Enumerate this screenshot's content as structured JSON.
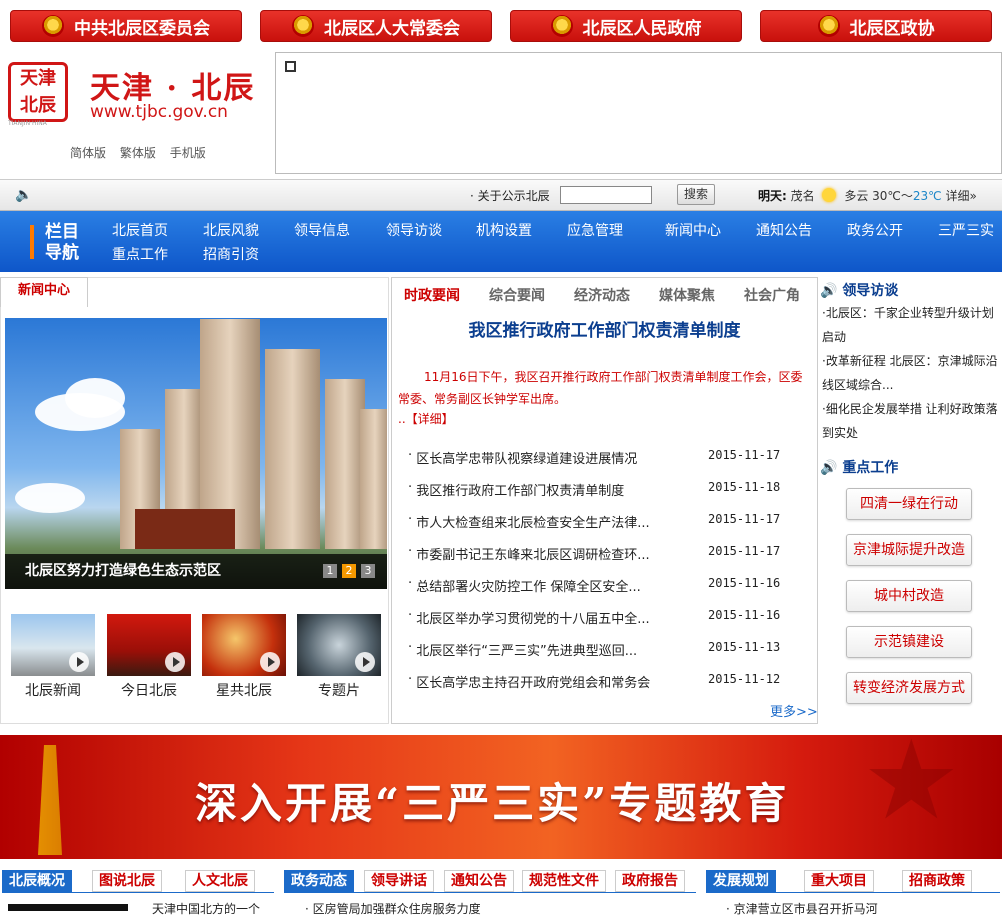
{
  "top_links": [
    "中共北辰区委员会",
    "北辰区人大常委会",
    "北辰区人民政府",
    "北辰区政协"
  ],
  "header": {
    "seal_text": [
      "天津",
      "北辰"
    ],
    "seal_sub": "TIANJIN·HINA",
    "title": "天津 · 北辰",
    "url": "www.tjbc.gov.cn",
    "versions": [
      "简体版",
      "繁体版",
      "手机版"
    ]
  },
  "toolbar": {
    "notice": "· 关于公示北辰",
    "search_label": "搜索",
    "weather": {
      "day": "明天:",
      "city": "茂名",
      "cond": "多云",
      "high": "30℃～",
      "low": "23℃",
      "detail": "详细»"
    }
  },
  "nav": {
    "title_line1": "栏目",
    "title_line2": "导航",
    "row1": [
      "北辰首页",
      "北辰风貌",
      "领导信息",
      "领导访谈",
      "机构设置",
      "应急管理",
      "新闻中心",
      "通知公告",
      "政务公开",
      "三严三实"
    ],
    "row2": [
      "重点工作",
      "招商引资"
    ]
  },
  "news_center": {
    "tab": "新闻中心",
    "caption": "北辰区努力打造绿色生态示范区",
    "pages": [
      "1",
      "2",
      "3"
    ],
    "thumbs": [
      "北辰新闻",
      "今日北辰",
      "星共北辰",
      "专题片"
    ]
  },
  "middle": {
    "tabs": [
      "时政要闻",
      "综合要闻",
      "经济动态",
      "媒体聚焦",
      "社会广角"
    ],
    "headline": "我区推行政府工作部门权责清单制度",
    "summary": "11月16日下午，我区召开推行政府工作部门权责清单制度工作会，区委常委、常务副区长钟学军出席。",
    "detail": "..【详细】",
    "items": [
      {
        "title": "区长高学忠带队视察绿道建设进展情况",
        "date": "2015-11-17"
      },
      {
        "title": "我区推行政府工作部门权责清单制度",
        "date": "2015-11-18"
      },
      {
        "title": "市人大检查组来北辰检查安全生产法律...",
        "date": "2015-11-17"
      },
      {
        "title": "市委副书记王东峰来北辰区调研检查环...",
        "date": "2015-11-17"
      },
      {
        "title": "总结部署火灾防控工作 保障全区安全...",
        "date": "2015-11-16"
      },
      {
        "title": "北辰区举办学习贯彻党的十八届五中全...",
        "date": "2015-11-16"
      },
      {
        "title": "北辰区举行“三严三实”先进典型巡回...",
        "date": "2015-11-13"
      },
      {
        "title": "区长高学忠主持召开政府党组会和常务会",
        "date": "2015-11-12"
      }
    ],
    "more": "更多>>"
  },
  "right": {
    "leader_title": "领导访谈",
    "leader_items": [
      "·北辰区：千家企业转型升级计划启动",
      "·改革新征程 北辰区：京津城际沿线区域综合...",
      "·细化民企发展举措 让利好政策落到实处"
    ],
    "key_title": "重点工作",
    "key_buttons": [
      "四清一绿在行动",
      "京津城际提升改造",
      "城中村改造",
      "示范镇建设",
      "转变经济发展方式"
    ]
  },
  "banner": {
    "text": "深入开展“三严三实”专题教育"
  },
  "bottom": {
    "group1": [
      "北辰概况",
      "图说北辰",
      "人文北辰"
    ],
    "group2": [
      "政务动态",
      "领导讲话",
      "通知公告",
      "规范性文件",
      "政府报告"
    ],
    "group3": [
      "发展规划",
      "重大项目",
      "招商政策"
    ],
    "snippets": [
      "天津中国北方的一个",
      "· 区房管局加强群众住房服务力度",
      "· 京津营立区市县召开折马河"
    ]
  }
}
